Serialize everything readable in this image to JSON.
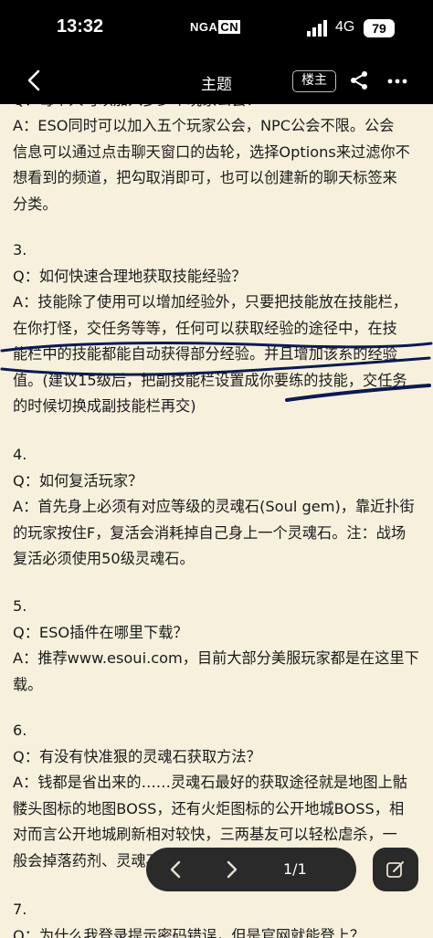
{
  "status_bar": {
    "time": "13:32",
    "logo": "NGA",
    "logo_suffix": "CN",
    "network": "4G",
    "battery": "79"
  },
  "nav": {
    "title": "主题",
    "op_badge": "楼主",
    "icons": [
      "back-icon",
      "share-icon",
      "more-icon"
    ]
  },
  "post": {
    "cut_top_line": "Q：每个人可以加入多少个玩家公会？",
    "answer2": [
      "A：ESO同时可以加入五个玩家公会，NPC公会不限。公会",
      "信息可以通过点击聊天窗口的齿轮，选择Options来过滤你不",
      "想看到的频道，把勾取消即可，也可以创建新的聊天标签来",
      "分类。"
    ],
    "items": [
      {
        "num": "3.",
        "q": "Q：如何快速合理地获取技能经验？",
        "a": [
          "A：技能除了使用可以增加经验外，只要把技能放在技能栏，",
          "在你打怪，交任务等等，任何可以获取经验的途径中，在技",
          "能栏中的技能都能自动获得部分经验。并且增加该系的经验",
          "值。(建议15级后，把副技能栏设置成你要练的技能，交任务",
          "的时候切换成副技能栏再交)"
        ]
      },
      {
        "num": "4.",
        "q": "Q：如何复活玩家？",
        "a": [
          "A：首先身上必须有对应等级的灵魂石(Soul gem)，靠近扑街",
          "的玩家按住F，复活会消耗掉自己身上一个灵魂石。注：战场",
          "复活必须使用50级灵魂石。"
        ]
      },
      {
        "num": "5.",
        "q": "Q：ESO插件在哪里下载？",
        "a": [
          "A：推荐www.esoui.com，目前大部分美服玩家都是在这里下",
          "载。"
        ]
      },
      {
        "num": "6.",
        "q": "Q：有没有快准狠的灵魂石获取方法？",
        "a": [
          "A：钱都是省出来的……灵魂石最好的获取途径就是地图上骷",
          "髅头图标的地图BOSS，还有火炬图标的公开地城BOSS，相",
          "对而言公开地城刷新相对较快，三两基友可以轻松虐杀，一",
          "般会掉落药剂、灵魂石、装备、藏宝图等。"
        ]
      },
      {
        "num": "7.",
        "q": "Q：为什么我登录提示密码错误，但是官网就能登上？",
        "a": []
      }
    ]
  },
  "pager": {
    "page": "1/1",
    "icons": [
      "chevron-left-icon",
      "chevron-right-icon",
      "edit-icon"
    ]
  },
  "colors": {
    "background": "#f6f0dd",
    "bar": "#000000",
    "annotation": "#0b1a52"
  }
}
